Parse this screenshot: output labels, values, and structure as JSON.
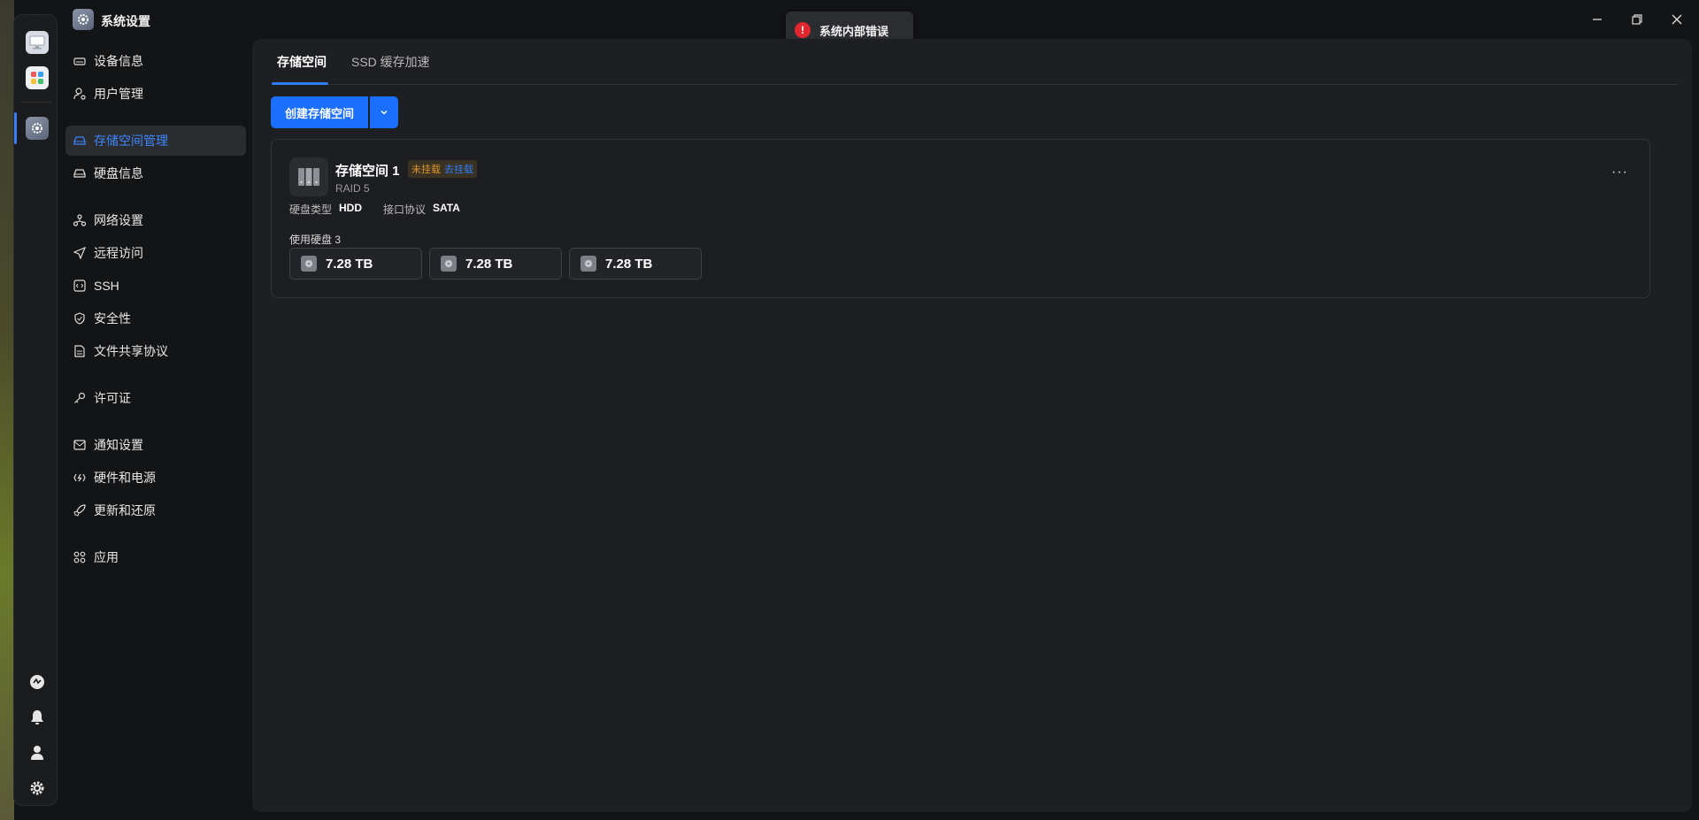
{
  "window": {
    "title": "系统设置",
    "controls": [
      "minimize-icon",
      "maximize-icon",
      "close-icon"
    ]
  },
  "toast": {
    "message": "系统内部错误",
    "status_color": "#e0272f"
  },
  "dock": {
    "top_apps": [
      "monitor-app-icon",
      "app-center-icon",
      "settings-app-icon"
    ],
    "active": "settings-app-icon",
    "bottom_icons": [
      "service-icon",
      "bell-icon",
      "user-icon",
      "gear-icon"
    ]
  },
  "sidebar": {
    "items": [
      {
        "label": "设备信息",
        "icon": "device-icon"
      },
      {
        "label": "用户管理",
        "icon": "user-manage-icon"
      },
      {
        "label": "存储空间管理",
        "icon": "storage-icon",
        "active": true
      },
      {
        "label": "硬盘信息",
        "icon": "harddisk-icon"
      },
      {
        "label": "网络设置",
        "icon": "network-icon"
      },
      {
        "label": "远程访问",
        "icon": "send-icon"
      },
      {
        "label": "SSH",
        "icon": "terminal-icon"
      },
      {
        "label": "安全性",
        "icon": "shield-icon"
      },
      {
        "label": "文件共享协议",
        "icon": "file-icon"
      },
      {
        "label": "许可证",
        "icon": "key-icon"
      },
      {
        "label": "通知设置",
        "icon": "mail-icon"
      },
      {
        "label": "硬件和电源",
        "icon": "power-icon"
      },
      {
        "label": "更新和还原",
        "icon": "rocket-icon"
      },
      {
        "label": "应用",
        "icon": "apps-icon"
      }
    ]
  },
  "main": {
    "tabs": [
      {
        "label": "存储空间",
        "active": true
      },
      {
        "label": "SSD 缓存加速",
        "active": false
      }
    ],
    "create_button": "创建存储空间",
    "pool": {
      "name": "存储空间 1",
      "status": "未挂载",
      "action_link": "去挂载",
      "raid": "RAID 5",
      "disk_type_label": "硬盘类型",
      "disk_type": "HDD",
      "interface_label": "接口协议",
      "interface": "SATA",
      "used_disks_label": "使用硬盘 3",
      "disks": [
        "7.28 TB",
        "7.28 TB",
        "7.28 TB"
      ],
      "more": "···"
    }
  },
  "colors": {
    "accent": "#1b6fff",
    "active_nav_text": "#3d86ff",
    "warning": "#e0962b"
  }
}
